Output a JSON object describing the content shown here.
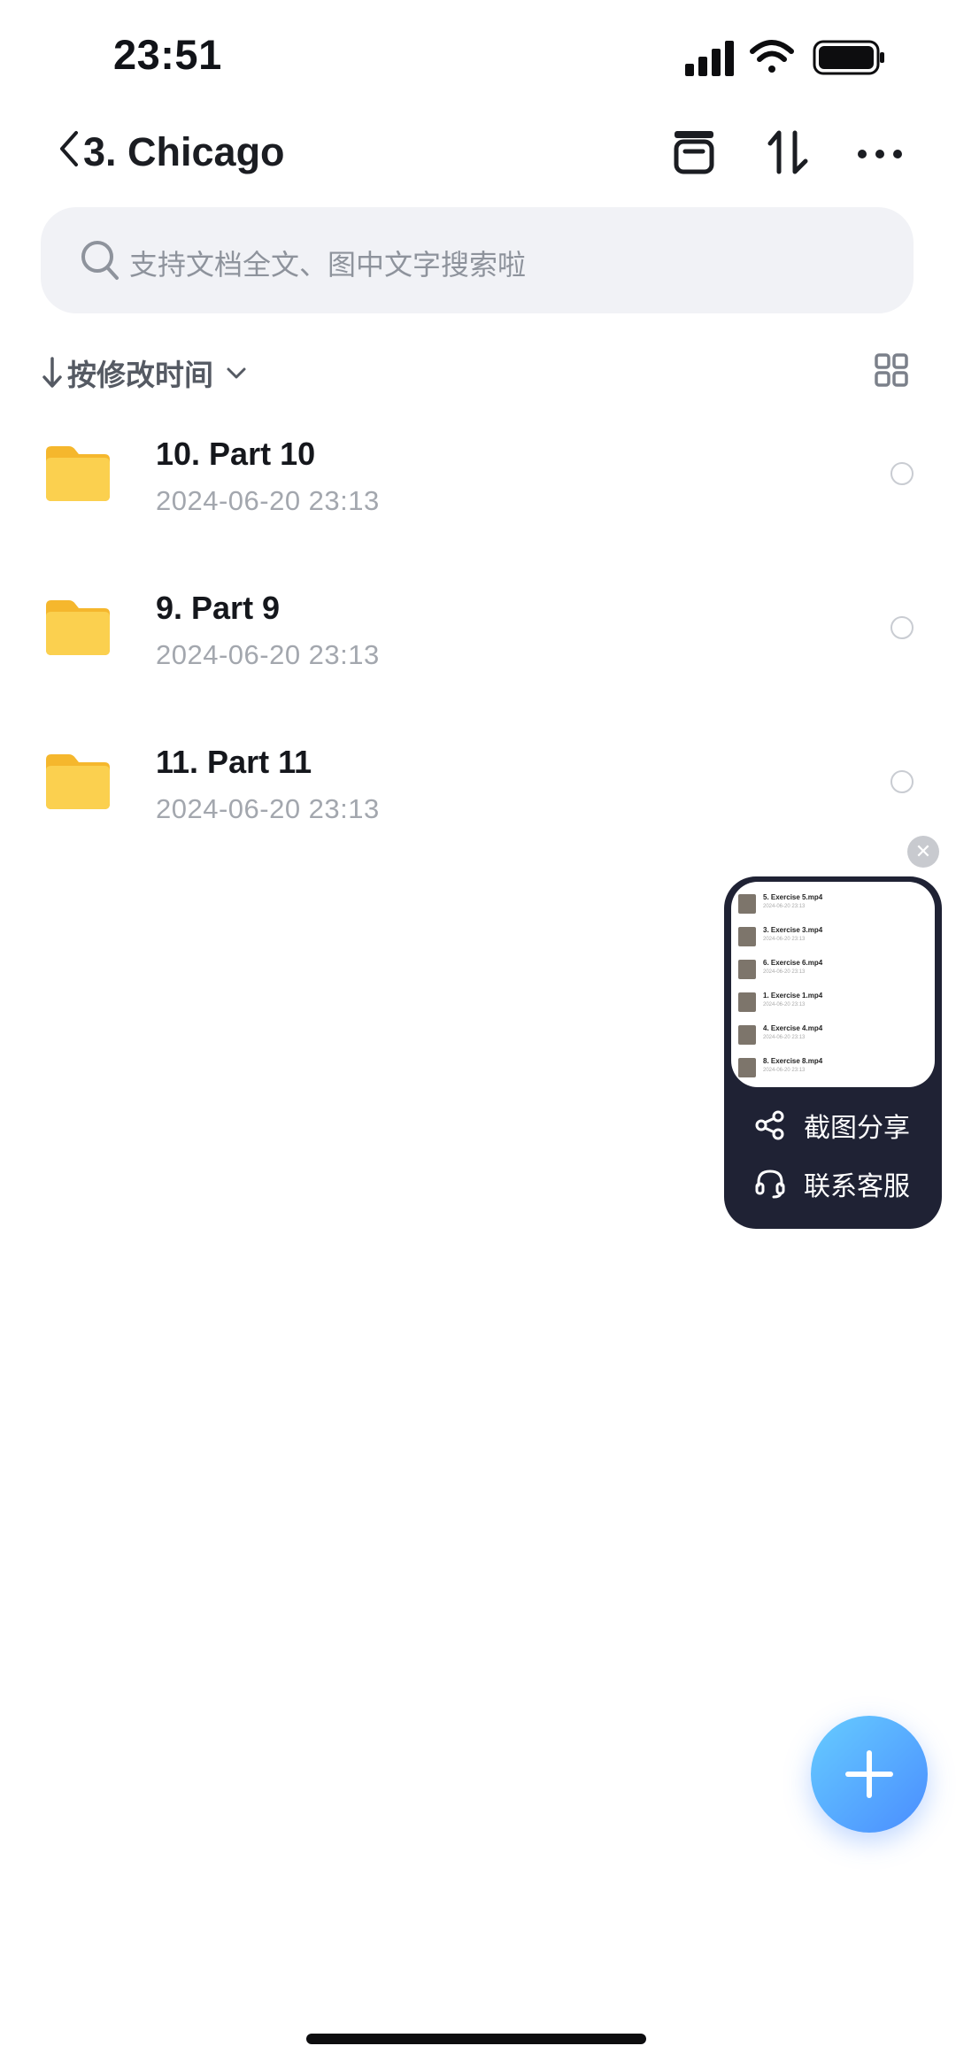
{
  "status_bar": {
    "time": "23:51"
  },
  "header": {
    "title": "3. Chicago",
    "icons": [
      "back-icon",
      "archive-icon",
      "sort-toggle-icon",
      "more-icon"
    ]
  },
  "search": {
    "placeholder": "支持文档全文、图中文字搜索啦"
  },
  "sort": {
    "label": "按修改时间"
  },
  "files": [
    {
      "name": "10. Part 10",
      "date": "2024-06-20 23:13"
    },
    {
      "name": "9. Part 9",
      "date": "2024-06-20 23:13"
    },
    {
      "name": "11. Part 11",
      "date": "2024-06-20 23:13"
    }
  ],
  "floating_widget": {
    "preview_items": [
      {
        "name": "5. Exercise 5.mp4",
        "date": "2024-06-20 23:13"
      },
      {
        "name": "3. Exercise 3.mp4",
        "date": "2024-06-20 23:13"
      },
      {
        "name": "6. Exercise 6.mp4",
        "date": "2024-06-20 23:13"
      },
      {
        "name": "1. Exercise 1.mp4",
        "date": "2024-06-20 23:13"
      },
      {
        "name": "4. Exercise 4.mp4",
        "date": "2024-06-20 23:13"
      },
      {
        "name": "8. Exercise 8.mp4",
        "date": "2024-06-20 23:13"
      }
    ],
    "share_label": "截图分享",
    "support_label": "联系客服"
  },
  "colors": {
    "accent": "#4a8dff",
    "folder": "#f9c940",
    "widget_bg": "#1f2234"
  }
}
